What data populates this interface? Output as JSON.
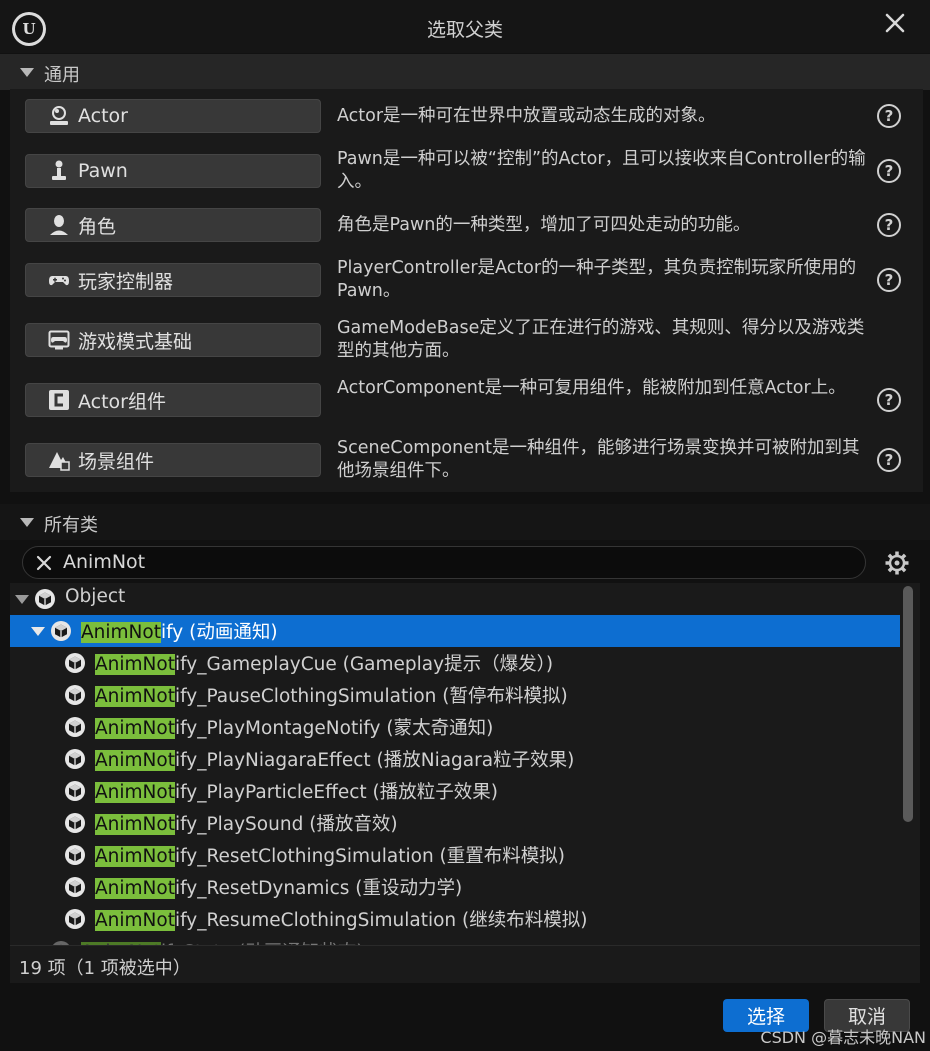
{
  "window": {
    "title": "选取父类"
  },
  "common_section": {
    "header": "通用",
    "items": [
      {
        "label": "Actor",
        "icon": "actor-icon",
        "description": "Actor是一种可在世界中放置或动态生成的对象。",
        "has_help": true
      },
      {
        "label": "Pawn",
        "icon": "pawn-icon",
        "description": "Pawn是一种可以被“控制”的Actor，且可以接收来自Controller的输入。",
        "has_help": true
      },
      {
        "label": "角色",
        "icon": "character-icon",
        "description": "角色是Pawn的一种类型，增加了可四处走动的功能。",
        "has_help": true
      },
      {
        "label": "玩家控制器",
        "icon": "gamepad-icon",
        "description": "PlayerController是Actor的一种子类型，其负责控制玩家所使用的Pawn。",
        "has_help": true
      },
      {
        "label": "游戏模式基础",
        "icon": "game-mode-icon",
        "description": "GameModeBase定义了正在进行的游戏、其规则、得分以及游戏类型的其他方面。",
        "has_help": false
      },
      {
        "label": "Actor组件",
        "icon": "component-icon",
        "description": "ActorComponent是一种可复用组件，能被附加到任意Actor上。",
        "has_help": true
      },
      {
        "label": "场景组件",
        "icon": "scene-component-icon",
        "description": "SceneComponent是一种组件，能够进行场景变换并可被附加到其他场景组件下。",
        "has_help": true
      }
    ]
  },
  "all_classes_section": {
    "header": "所有类",
    "search": {
      "value": "AnimNot"
    }
  },
  "tree": [
    {
      "match": "",
      "rest": "Object",
      "level": 0,
      "expanded": true,
      "selected": false
    },
    {
      "match": "AnimNot",
      "rest": "ify (动画通知)",
      "level": 1,
      "expanded": true,
      "selected": true
    },
    {
      "match": "AnimNot",
      "rest": "ify_GameplayCue (Gameplay提示（爆发）)",
      "level": 2,
      "selected": false
    },
    {
      "match": "AnimNot",
      "rest": "ify_PauseClothingSimulation (暂停布料模拟)",
      "level": 2,
      "selected": false
    },
    {
      "match": "AnimNot",
      "rest": "ify_PlayMontageNotify (蒙太奇通知)",
      "level": 2,
      "selected": false
    },
    {
      "match": "AnimNot",
      "rest": "ify_PlayNiagaraEffect (播放Niagara粒子效果)",
      "level": 2,
      "selected": false
    },
    {
      "match": "AnimNot",
      "rest": "ify_PlayParticleEffect (播放粒子效果)",
      "level": 2,
      "selected": false
    },
    {
      "match": "AnimNot",
      "rest": "ify_PlaySound (播放音效)",
      "level": 2,
      "selected": false
    },
    {
      "match": "AnimNot",
      "rest": "ify_ResetClothingSimulation (重置布料模拟)",
      "level": 2,
      "selected": false
    },
    {
      "match": "AnimNot",
      "rest": "ify_ResetDynamics (重设动力学)",
      "level": 2,
      "selected": false
    },
    {
      "match": "AnimNot",
      "rest": "ify_ResumeClothingSimulation (继续布料模拟)",
      "level": 2,
      "selected": false
    },
    {
      "match": "AnimNot",
      "rest": "ifyState (动画通知状态)",
      "level": 1,
      "selected": false,
      "cutoff": true
    }
  ],
  "status": {
    "text": "19 项（1 项被选中）"
  },
  "buttons": {
    "select": "选择",
    "cancel": "取消"
  },
  "watermark": "CSDN @暮志未晚NAN",
  "colors": {
    "accent": "#0d6ed1",
    "search_highlight": "#7bbe3c"
  }
}
